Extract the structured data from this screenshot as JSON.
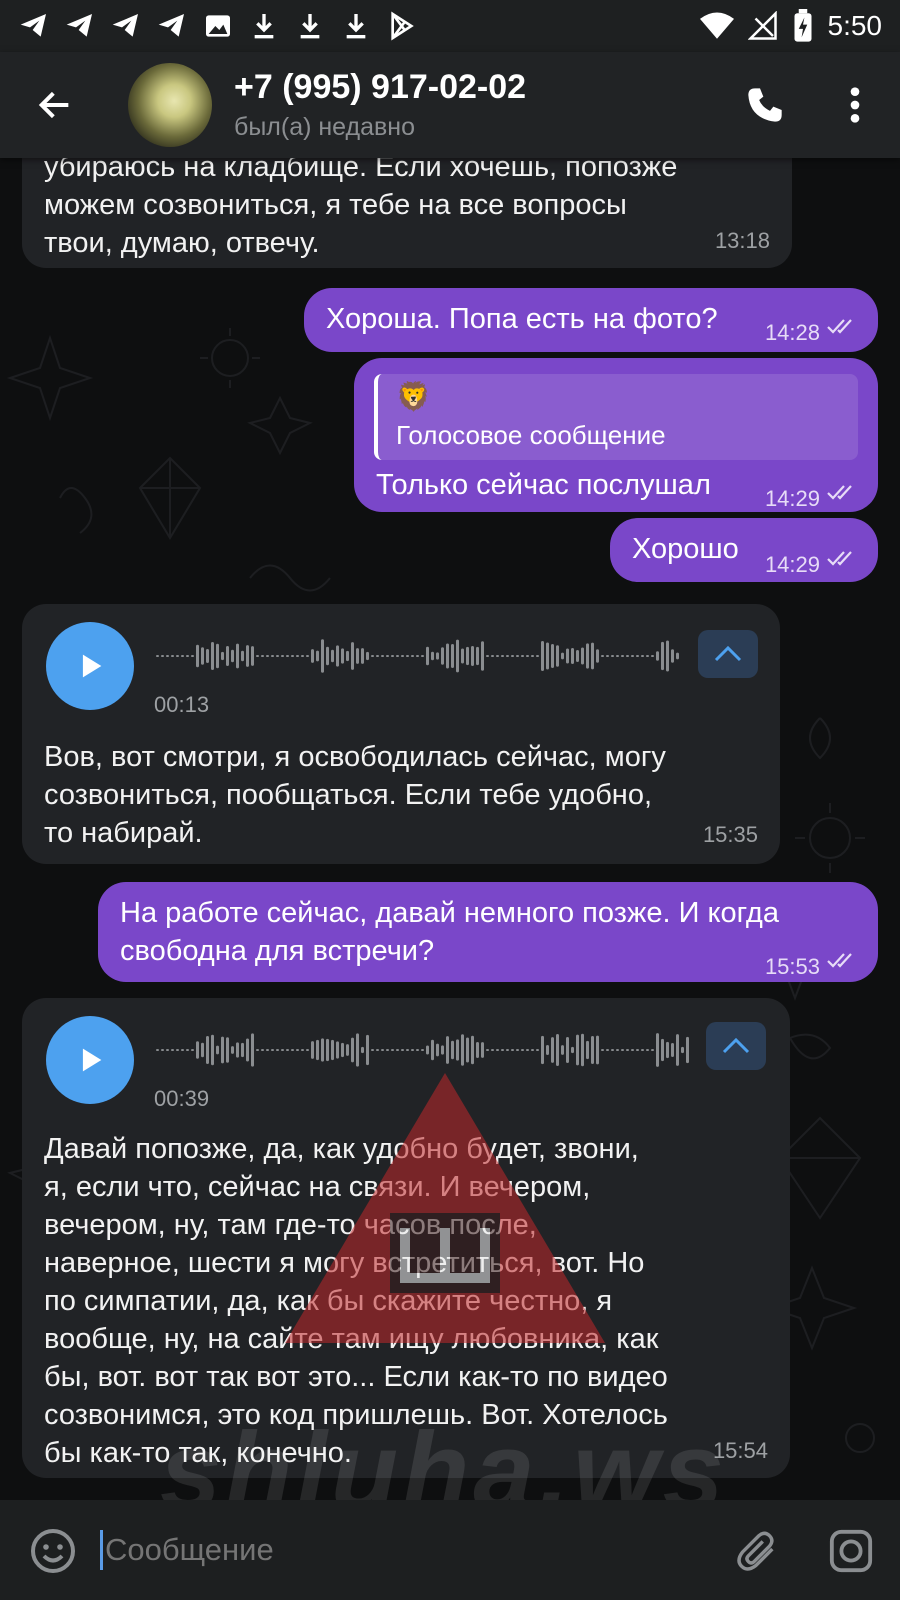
{
  "status_bar": {
    "time": "5:50"
  },
  "header": {
    "contact_name": "+7 (995) 917-02-02",
    "last_seen": "был(а) недавно"
  },
  "messages": [
    {
      "dir": "in",
      "lines": [
        "убираюсь на кладбище. Если хочешь, попозже",
        "можем созвониться, я тебе на все вопросы",
        "твои, думаю, отвечу."
      ],
      "time": "13:18"
    },
    {
      "dir": "out",
      "text": "Хороша. Попа есть на фото?",
      "time": "14:28"
    },
    {
      "dir": "out",
      "reply_emoji": "🦁",
      "reply_text": "Голосовое сообщение",
      "text": "Только сейчас послушал",
      "time": "14:29"
    },
    {
      "dir": "out",
      "text": "Хорошо",
      "time": "14:29"
    },
    {
      "dir": "in",
      "voice_duration": "00:13",
      "lines": [
        "Вов, вот смотри, я освободилась сейчас, могу",
        "созвониться, пообщаться. Если тебе удобно,",
        "то набирай."
      ],
      "time": "15:35"
    },
    {
      "dir": "out",
      "lines": [
        "На работе сейчас, давай немного позже. И когда",
        "свободна для встречи?"
      ],
      "time": "15:53"
    },
    {
      "dir": "in",
      "voice_duration": "00:39",
      "lines": [
        "Давай попозже, да, как удобно будет, звони,",
        "я, если что, сейчас на связи. И вечером,",
        "вечером, ну, там где-то часов после,",
        "наверное, шести я могу встретиться, вот. Но",
        "по симпатии, да, как бы скажите честно, я",
        "вообще, ну, на сайте там ищу любовника, как",
        "бы, вот. вот так вот это... Если как-то по видео",
        "созвонимся, это код пришлешь. Вот. Хотелось",
        "бы как-то так, конечно."
      ],
      "time": "15:54"
    }
  ],
  "watermark": "shluha.ws",
  "input": {
    "placeholder": "Сообщение"
  },
  "colors": {
    "outgoing_bubble": "#7a47c9",
    "incoming_bubble": "#212326",
    "play_button": "#4da1ef",
    "header": "#212325"
  }
}
